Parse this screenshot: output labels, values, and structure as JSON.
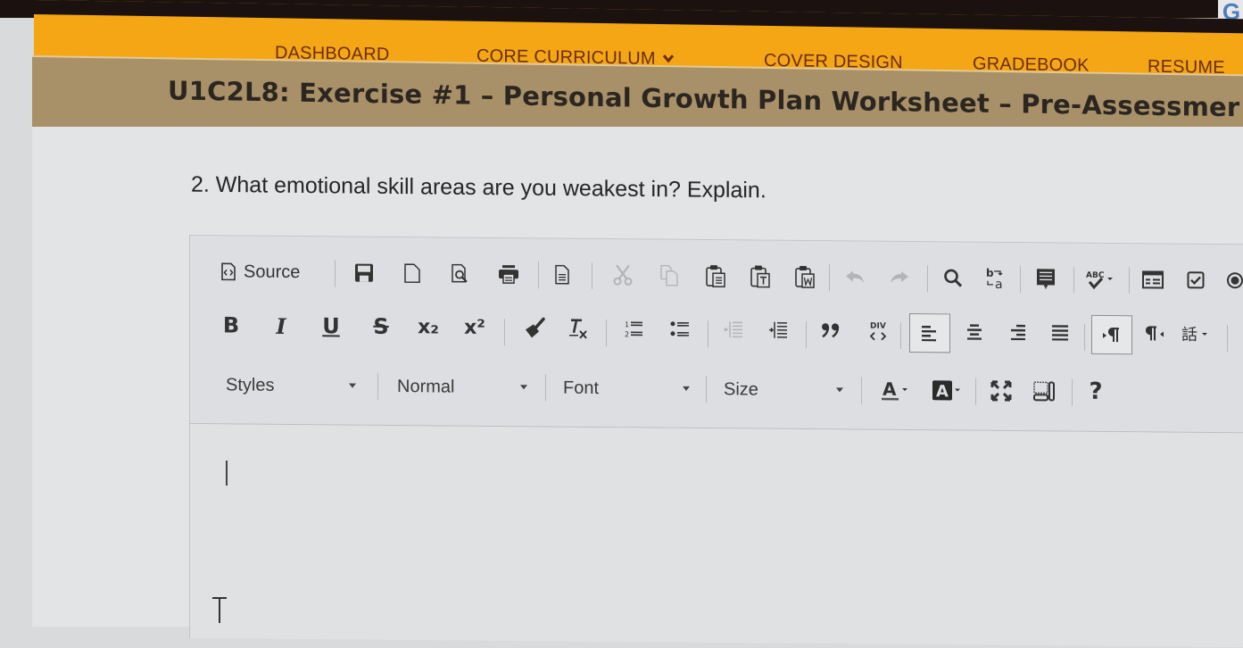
{
  "browser": {
    "extension_icon": "google-g-icon"
  },
  "nav": {
    "items": [
      {
        "label": "DASHBOARD",
        "has_dropdown": false
      },
      {
        "label": "CORE CURRICULUM",
        "has_dropdown": true,
        "dropdown_icon": "chevron-down-icon"
      },
      {
        "label": "COVER DESIGN",
        "has_dropdown": false
      },
      {
        "label": "GRADEBOOK",
        "has_dropdown": false
      },
      {
        "label": "RESUME",
        "has_dropdown": false
      }
    ]
  },
  "page": {
    "title": "U1C2L8: Exercise #1 – Personal Growth Plan Worksheet – Pre-Assessmer",
    "question": "2. What emotional skill areas are you weakest in? Explain."
  },
  "colors": {
    "nav_bg": "#f4a614",
    "nav_text": "#6b2d10",
    "title_bg": "#a89068",
    "top_bar": "#1b1210"
  },
  "editor": {
    "toolbar_row1": [
      {
        "icon": "source-icon",
        "label": "Source"
      },
      {
        "icon": "save-icon"
      },
      {
        "icon": "new-page-icon"
      },
      {
        "icon": "preview-icon"
      },
      {
        "icon": "print-icon"
      },
      {
        "icon": "templates-icon"
      },
      {
        "icon": "cut-icon",
        "disabled": true
      },
      {
        "icon": "copy-icon",
        "disabled": true
      },
      {
        "icon": "paste-icon"
      },
      {
        "icon": "paste-text-icon"
      },
      {
        "icon": "paste-from-word-icon"
      },
      {
        "icon": "undo-icon",
        "disabled": true
      },
      {
        "icon": "redo-icon",
        "disabled": true
      },
      {
        "icon": "find-icon"
      },
      {
        "icon": "replace-icon"
      },
      {
        "icon": "select-all-icon"
      },
      {
        "icon": "spellcheck-icon"
      },
      {
        "icon": "form-icon"
      },
      {
        "icon": "checkbox-icon"
      },
      {
        "icon": "radio-icon"
      }
    ],
    "toolbar_row2": [
      {
        "icon": "bold-icon",
        "glyph": "B"
      },
      {
        "icon": "italic-icon",
        "glyph": "I"
      },
      {
        "icon": "underline-icon",
        "glyph": "U"
      },
      {
        "icon": "strikethrough-icon",
        "glyph": "S"
      },
      {
        "icon": "subscript-icon",
        "glyph": "x₂"
      },
      {
        "icon": "superscript-icon",
        "glyph": "x²"
      },
      {
        "icon": "copy-formatting-icon"
      },
      {
        "icon": "remove-format-icon"
      },
      {
        "icon": "numbered-list-icon"
      },
      {
        "icon": "bulleted-list-icon"
      },
      {
        "icon": "decrease-indent-icon",
        "disabled": true
      },
      {
        "icon": "increase-indent-icon"
      },
      {
        "icon": "blockquote-icon"
      },
      {
        "icon": "create-div-icon",
        "glyph": "DIV"
      },
      {
        "icon": "align-left-icon",
        "active": true
      },
      {
        "icon": "align-center-icon"
      },
      {
        "icon": "align-right-icon"
      },
      {
        "icon": "justify-icon"
      },
      {
        "icon": "text-direction-ltr-icon",
        "active": true
      },
      {
        "icon": "text-direction-rtl-icon"
      },
      {
        "icon": "language-icon"
      }
    ],
    "toolbar_row3": {
      "styles": {
        "label": "Styles"
      },
      "format": {
        "label": "Normal"
      },
      "font": {
        "label": "Font"
      },
      "size": {
        "label": "Size"
      },
      "buttons": [
        {
          "icon": "text-color-icon",
          "glyph": "A"
        },
        {
          "icon": "background-color-icon",
          "glyph": "A"
        },
        {
          "icon": "maximize-icon"
        },
        {
          "icon": "show-blocks-icon"
        },
        {
          "icon": "help-icon",
          "glyph": "?"
        }
      ]
    },
    "content": ""
  }
}
